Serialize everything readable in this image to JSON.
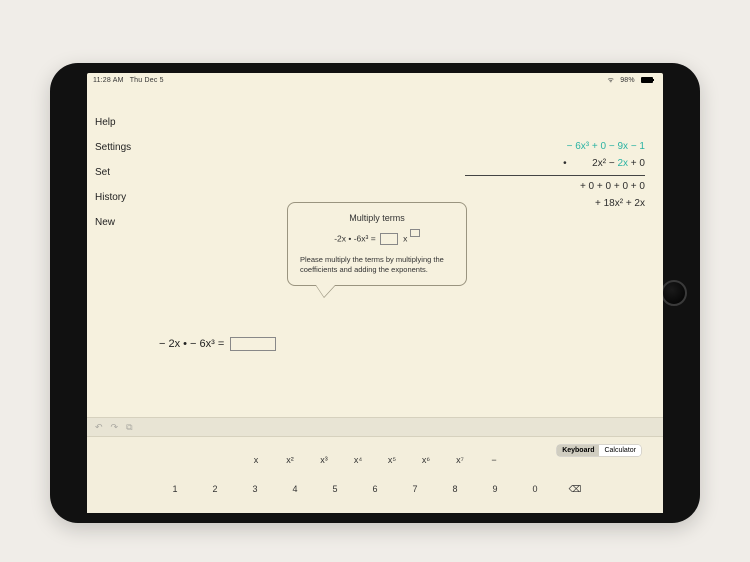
{
  "status": {
    "time": "11:28 AM",
    "date": "Thu Dec 5",
    "battery": "98%"
  },
  "sidebar": {
    "items": [
      {
        "label": "Help"
      },
      {
        "label": "Settings"
      },
      {
        "label": "Set"
      },
      {
        "label": "History"
      },
      {
        "label": "New"
      }
    ]
  },
  "math": {
    "multiplicand": "−  6x³  +  0  −  9x  −  1",
    "multiplier_prefix": "2x²  −  ",
    "multiplier_hilite": "2x",
    "multiplier_suffix": "  +  0",
    "op": "•",
    "partial1": "+  0  +  0  +  0  +  0",
    "partial2": "+ 18x²  +  2x"
  },
  "tooltip": {
    "title": "Multiply terms",
    "expr_lhs": "-2x   •   -6x³   =",
    "hint": "Please multiply the terms by multiplying the coefficients and adding the exponents."
  },
  "equation": {
    "lhs": "−  2x   •   −  6x³   ="
  },
  "toolbar": {
    "undo": "↶",
    "redo": "↷",
    "copy": "⧉"
  },
  "keyboard": {
    "segments": {
      "a": "Keyboard",
      "b": "Calculator"
    },
    "row_vars": [
      "x",
      "x²",
      "x³",
      "x⁴",
      "x⁵",
      "x⁶",
      "x⁷",
      "−"
    ],
    "row_nums": [
      "1",
      "2",
      "3",
      "4",
      "5",
      "6",
      "7",
      "8",
      "9",
      "0",
      "⌫"
    ]
  }
}
